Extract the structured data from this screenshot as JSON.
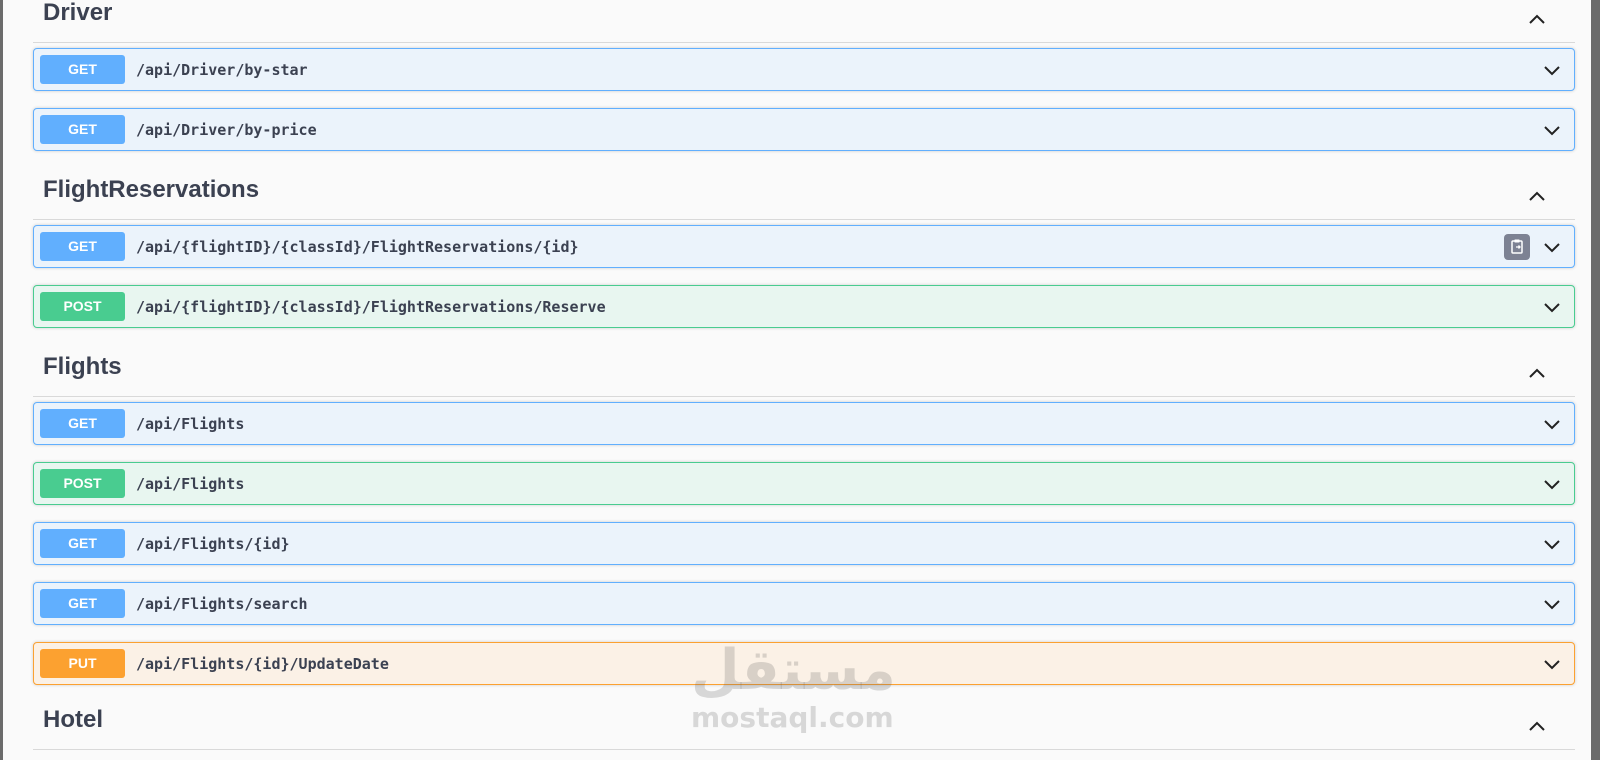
{
  "sections": [
    {
      "title": "Driver",
      "operations": [
        {
          "method": "GET",
          "path": "/api/Driver/by-star"
        },
        {
          "method": "GET",
          "path": "/api/Driver/by-price"
        }
      ]
    },
    {
      "title": "FlightReservations",
      "operations": [
        {
          "method": "GET",
          "path": "/api/{flightID}/{classId}/FlightReservations/{id}"
        },
        {
          "method": "POST",
          "path": "/api/{flightID}/{classId}/FlightReservations/Reserve"
        }
      ]
    },
    {
      "title": "Flights",
      "operations": [
        {
          "method": "GET",
          "path": "/api/Flights"
        },
        {
          "method": "POST",
          "path": "/api/Flights"
        },
        {
          "method": "GET",
          "path": "/api/Flights/{id}"
        },
        {
          "method": "GET",
          "path": "/api/Flights/search"
        },
        {
          "method": "PUT",
          "path": "/api/Flights/{id}/UpdateDate"
        }
      ]
    },
    {
      "title": "Hotel",
      "operations": []
    }
  ],
  "watermark": {
    "arabic": "مستقل",
    "latin": "mostaql.com"
  },
  "colors": {
    "get": "#61affe",
    "post": "#49cc90",
    "put": "#fca130",
    "text": "#3b4151"
  }
}
